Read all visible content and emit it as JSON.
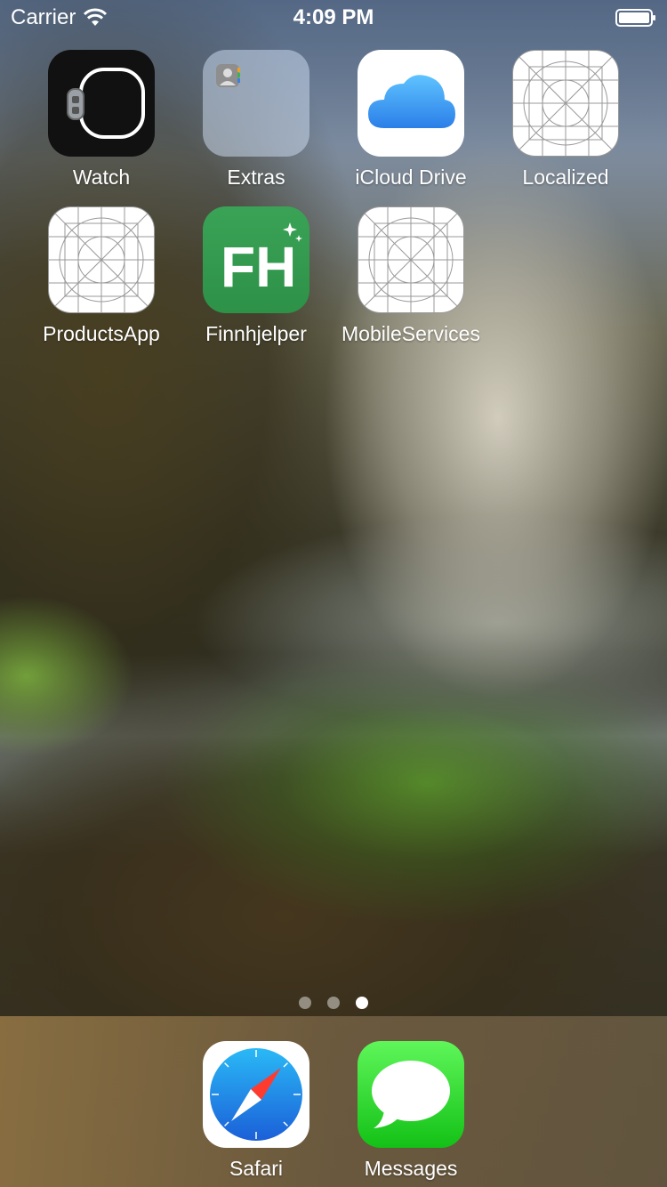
{
  "status_bar": {
    "carrier": "Carrier",
    "time": "4:09 PM",
    "wifi_icon": "wifi-icon",
    "battery_icon": "battery-icon",
    "battery_level": 1.0
  },
  "home": {
    "apps": [
      {
        "label": "Watch",
        "icon": "watch-app-icon"
      },
      {
        "label": "Extras",
        "icon": "folder-icon"
      },
      {
        "label": "iCloud Drive",
        "icon": "icloud-drive-icon"
      },
      {
        "label": "Localized",
        "icon": "placeholder-app-icon"
      },
      {
        "label": "ProductsApp",
        "icon": "placeholder-app-icon"
      },
      {
        "label": "Finnhjelper",
        "icon": "finnhjelper-icon",
        "icon_text": "FH"
      },
      {
        "label": "MobileServices",
        "icon": "placeholder-app-icon"
      }
    ],
    "page_count": 3,
    "current_page": 3
  },
  "dock": {
    "apps": [
      {
        "label": "Safari",
        "icon": "safari-icon"
      },
      {
        "label": "Messages",
        "icon": "messages-icon"
      }
    ]
  },
  "colors": {
    "finnhjelper_green": "#2d9148",
    "messages_green": "#13c116",
    "icloud_blue": "#3a9cf2",
    "safari_blue": "#1c7fe6"
  }
}
